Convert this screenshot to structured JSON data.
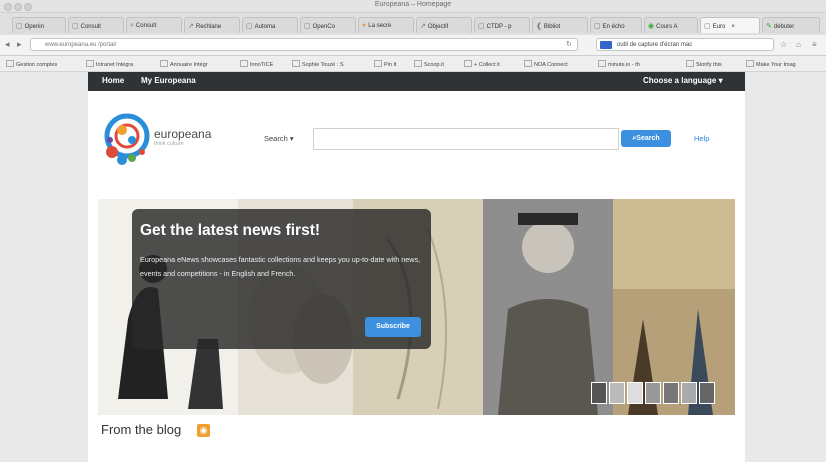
{
  "window": {
    "title": "Europeana – Homepage"
  },
  "tabs": [
    {
      "label": "Openin",
      "active": false
    },
    {
      "label": "Consult",
      "active": false
    },
    {
      "label": "Consult",
      "active": false
    },
    {
      "label": "Rechlane",
      "active": false
    },
    {
      "label": "Automa",
      "active": false
    },
    {
      "label": "OpenCo",
      "active": false
    },
    {
      "label": "La secre",
      "active": false
    },
    {
      "label": "Objectif",
      "active": false
    },
    {
      "label": "CTDP - p",
      "active": false
    },
    {
      "label": "Bibliot",
      "active": false
    },
    {
      "label": "En écho",
      "active": false
    },
    {
      "label": "Cours A",
      "active": false
    },
    {
      "label": "Euro",
      "active": true
    },
    {
      "label": "débuter",
      "active": false
    }
  ],
  "navbar": {
    "url": "www.europeana.eu /portal/",
    "search_value": "outil de capture d'écran mac"
  },
  "bookmarks": [
    "Gestion comptes",
    "Intranet Intégra",
    "Annuaire Intégr",
    "InnoTICE",
    "Sophie Touzé : S",
    "Pin It",
    "Scoop.it",
    "+ Collect it",
    "NOA Connect",
    "minute.io - th",
    "Storify this",
    "Make Your Imag"
  ],
  "site": {
    "nav": {
      "home": "Home",
      "my": "My Europeana",
      "language": "Choose a language ▾"
    },
    "brand": "europeana",
    "brand_sub": "think culture",
    "search": {
      "label": "Search ▾",
      "button": "Search",
      "placeholder": ""
    },
    "help": "Help",
    "hero": {
      "title": "Get the latest news first!",
      "body": "Europeana eNews showcases fantastic collections and keeps you up-to-date with news, events and competitions - in English and French.",
      "button": "Subscribe"
    },
    "blog_heading": "From the blog"
  },
  "colors": {
    "accent": "#3d8fe0",
    "topbar": "#2f3335",
    "rss": "#f0a030"
  },
  "icons": {
    "search": "search-icon",
    "rss": "rss-icon",
    "back": "back-icon",
    "forward": "forward-icon"
  }
}
